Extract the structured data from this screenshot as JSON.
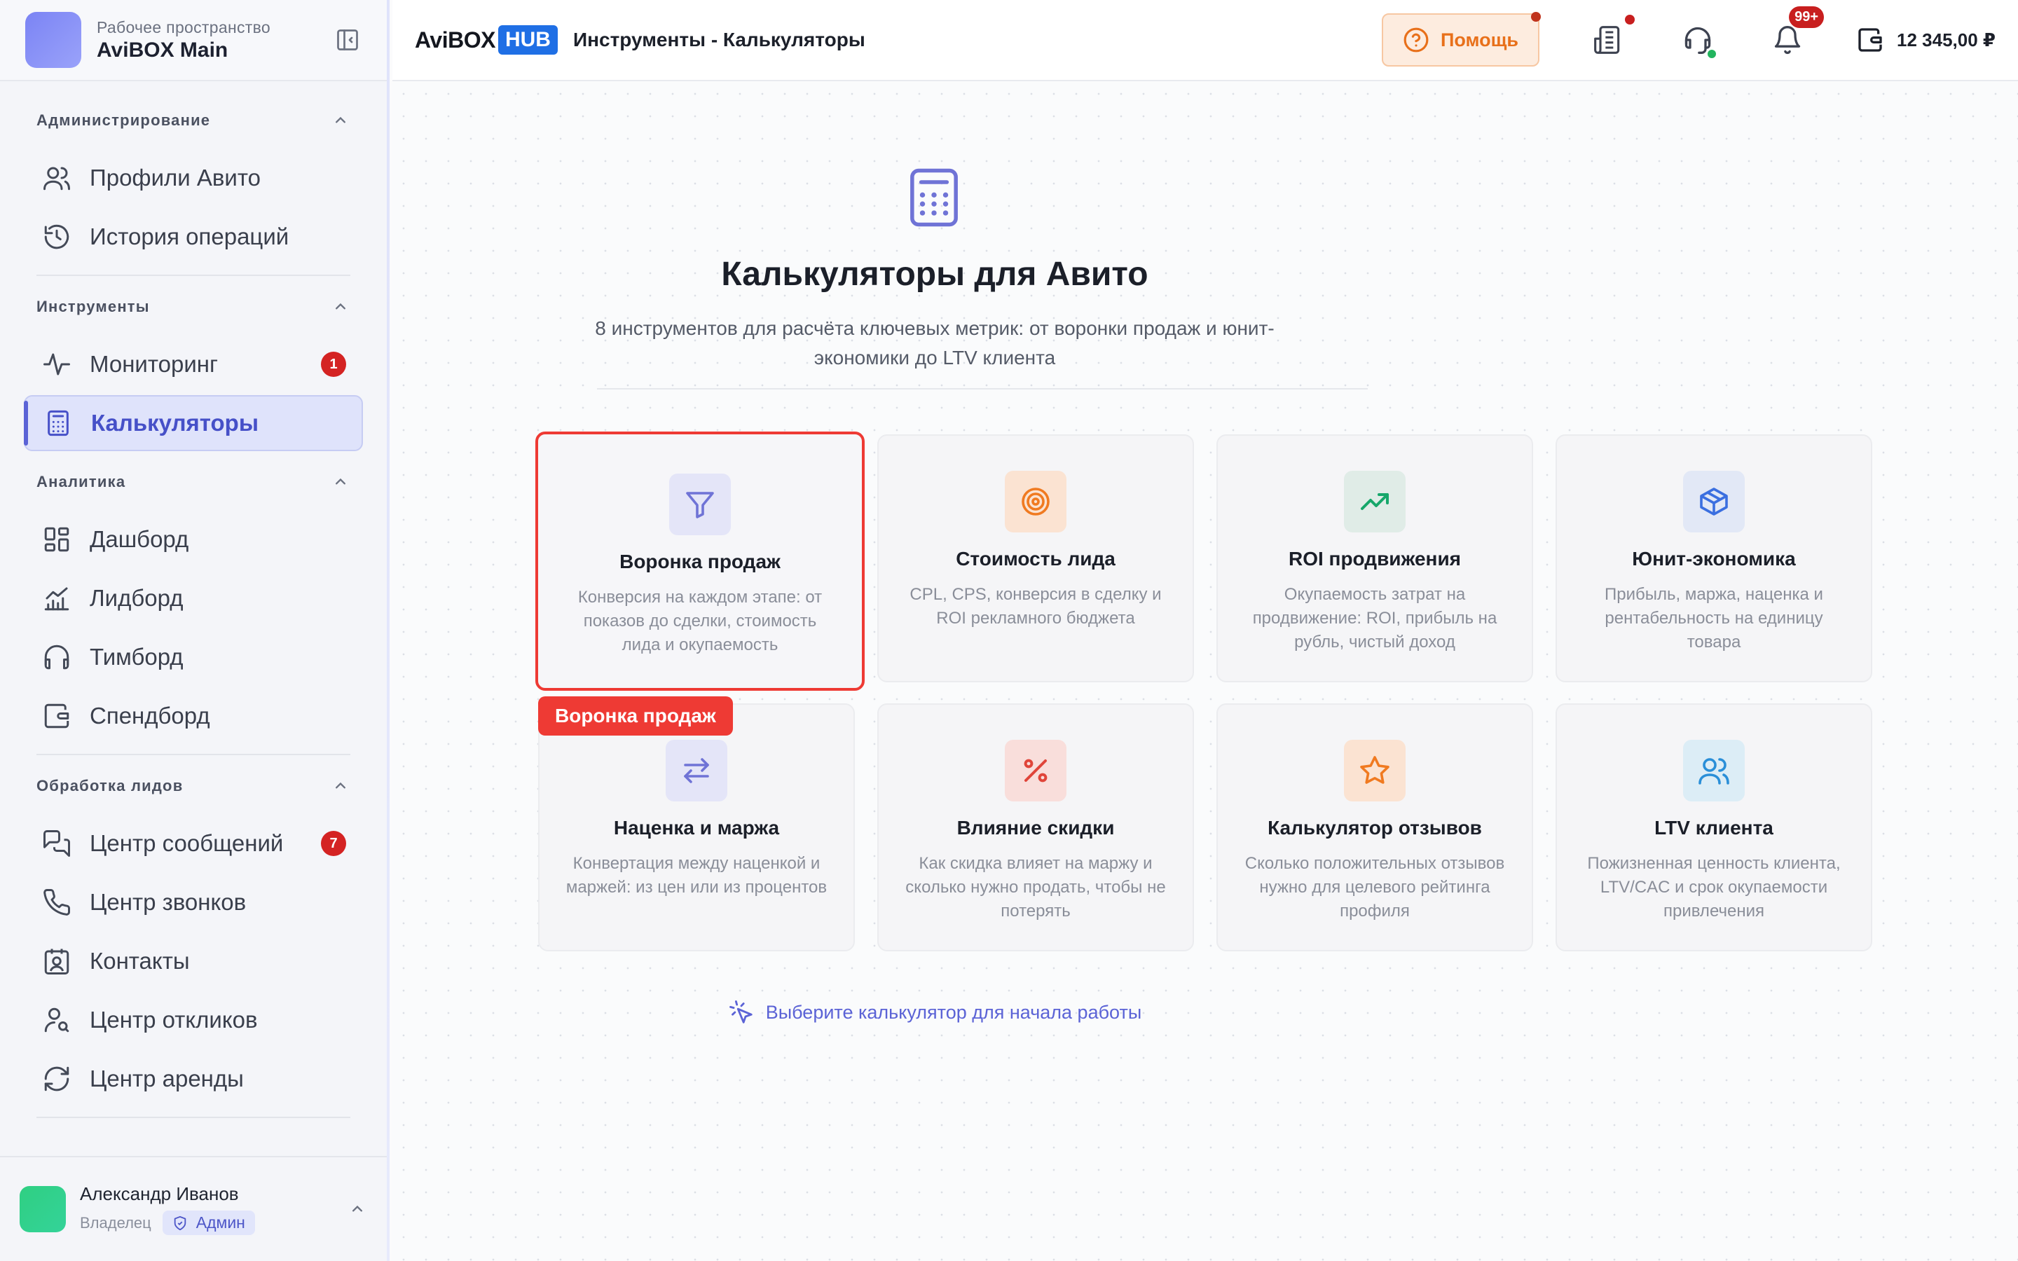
{
  "workspace": {
    "subtitle": "Рабочее пространство",
    "name": "AviBOX Main"
  },
  "sidebar": {
    "sections": [
      {
        "title": "Администрирование",
        "items": [
          {
            "label": "Профили Авито",
            "icon": "users-icon"
          },
          {
            "label": "История операций",
            "icon": "history-icon"
          }
        ]
      },
      {
        "title": "Инструменты",
        "items": [
          {
            "label": "Мониторинг",
            "icon": "activity-icon",
            "badge": "1"
          },
          {
            "label": "Калькуляторы",
            "icon": "calculator-icon",
            "active": true
          }
        ]
      },
      {
        "title": "Аналитика",
        "items": [
          {
            "label": "Дашборд",
            "icon": "dashboard-icon"
          },
          {
            "label": "Лидборд",
            "icon": "chart-icon"
          },
          {
            "label": "Тимборд",
            "icon": "headphones-icon"
          },
          {
            "label": "Спендборд",
            "icon": "wallet-icon"
          }
        ]
      },
      {
        "title": "Обработка лидов",
        "items": [
          {
            "label": "Центр сообщений",
            "icon": "messages-icon",
            "badge": "7"
          },
          {
            "label": "Центр звонков",
            "icon": "phone-icon"
          },
          {
            "label": "Контакты",
            "icon": "contacts-icon"
          },
          {
            "label": "Центр откликов",
            "icon": "user-search-icon"
          },
          {
            "label": "Центр аренды",
            "icon": "refresh-icon"
          }
        ]
      }
    ]
  },
  "user": {
    "name": "Александр Иванов",
    "role": "Владелец",
    "tag": "Админ"
  },
  "header": {
    "logo_text": "AviBOX",
    "logo_hub": "HUB",
    "breadcrumb": "Инструменты - Калькуляторы",
    "help_label": "Помощь",
    "notifications_count": "99+",
    "balance": "12 345,00 ₽"
  },
  "main": {
    "title": "Калькуляторы для Авито",
    "description": "8 инструментов для расчёта ключевых метрик: от воронки продаж и юнит-экономики до LTV клиента",
    "hint": "Выберите калькулятор для начала работы",
    "tooltip": "Воронка продаж",
    "cards": [
      {
        "title": "Воронка продаж",
        "desc": "Конверсия на каждом этапе: от показов до сделки, стоимость лида и окупаемость",
        "icon": "funnel-icon",
        "color": "#6f73d6",
        "bg": "#e4e5f8"
      },
      {
        "title": "Стоимость лида",
        "desc": "CPL, CPS, конверсия в сделку и ROI рекламного бюджета",
        "icon": "target-icon",
        "color": "#f07a20",
        "bg": "#fbe3d2"
      },
      {
        "title": "ROI продвижения",
        "desc": "Окупаемость затрат на продвижение: ROI, прибыль на рубль, чистый доход",
        "icon": "trending-up-icon",
        "color": "#16a76a",
        "bg": "#e0ece7"
      },
      {
        "title": "Юнит-экономика",
        "desc": "Прибыль, маржа, наценка и рентабельность на единицу товара",
        "icon": "box-icon",
        "color": "#3b6fe0",
        "bg": "#e2e8f6"
      },
      {
        "title": "Наценка и маржа",
        "desc": "Конвертация между наценкой и маржей: из цен или из процентов",
        "icon": "arrows-icon",
        "color": "#6f73d6",
        "bg": "#e4e5f8"
      },
      {
        "title": "Влияние скидки",
        "desc": "Как скидка влияет на маржу и сколько нужно продать, чтобы не потерять",
        "icon": "percent-icon",
        "color": "#e0453a",
        "bg": "#f9dedb"
      },
      {
        "title": "Калькулятор отзывов",
        "desc": "Сколько положительных отзывов нужно для целевого рейтинга профиля",
        "icon": "star-icon",
        "color": "#f07a20",
        "bg": "#fbe3d2"
      },
      {
        "title": "LTV клиента",
        "desc": "Пожизненная ценность клиента, LTV/CAC и срок окупаемости привлечения",
        "icon": "users-icon",
        "color": "#2a8fd8",
        "bg": "#dcedf6"
      }
    ]
  },
  "colors": {
    "accent": "#5b63d6",
    "highlight": "#ee3a34",
    "help": "#e8701a",
    "badge": "#d42323"
  }
}
